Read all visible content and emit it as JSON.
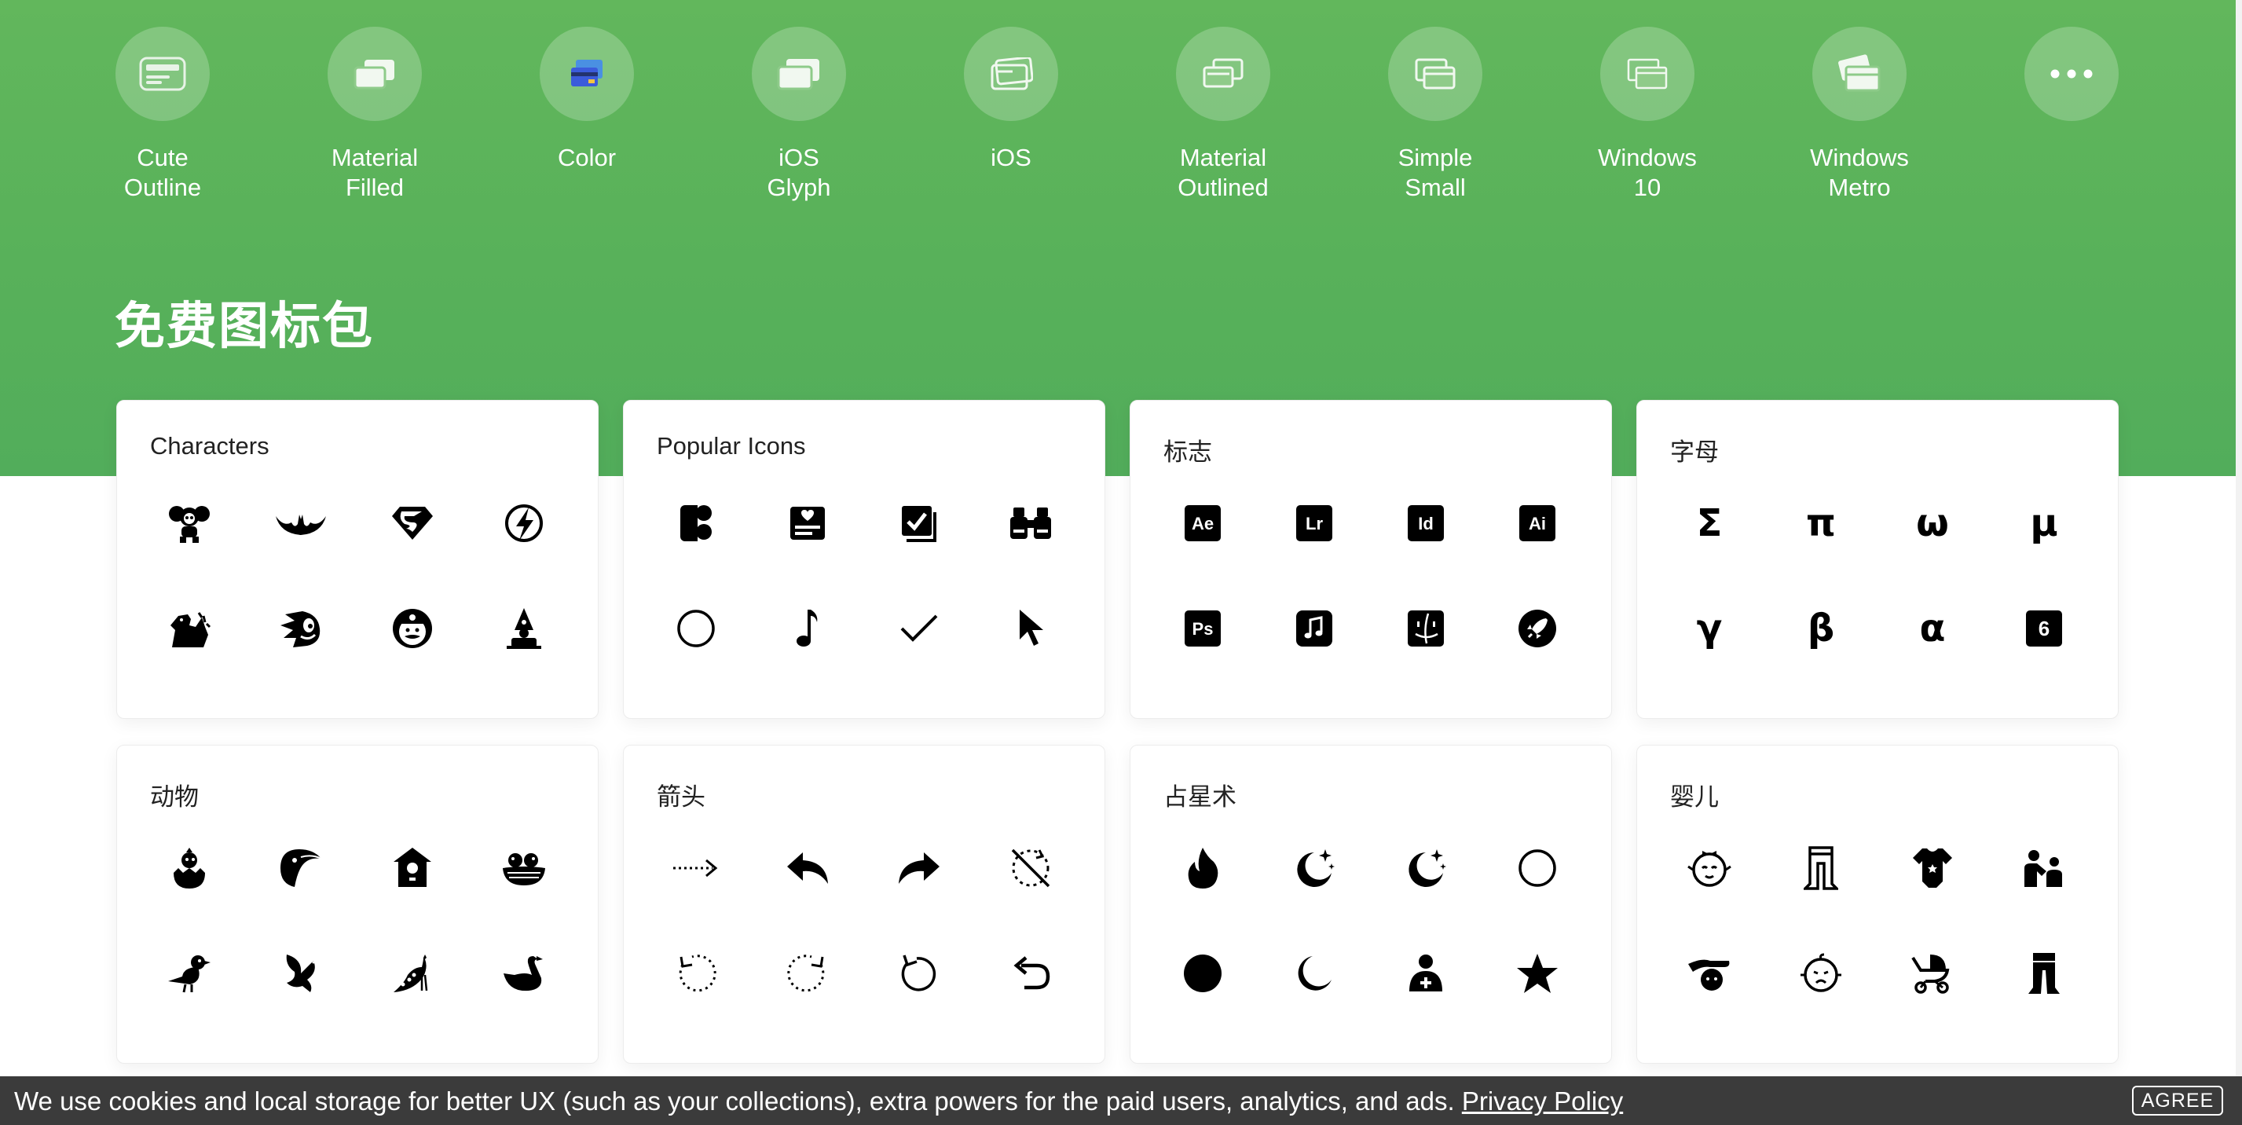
{
  "icon_styles": [
    {
      "label": "Cute\nOutline",
      "icon": "cute-outline-style-icon"
    },
    {
      "label": "Material\nFilled",
      "icon": "material-filled-style-icon"
    },
    {
      "label": "Color",
      "icon": "color-style-icon"
    },
    {
      "label": "iOS\nGlyph",
      "icon": "ios-glyph-style-icon"
    },
    {
      "label": "iOS",
      "icon": "ios-style-icon"
    },
    {
      "label": "Material\nOutlined",
      "icon": "material-outlined-style-icon"
    },
    {
      "label": "Simple\nSmall",
      "icon": "simple-small-style-icon"
    },
    {
      "label": "Windows\n10",
      "icon": "windows-10-style-icon"
    },
    {
      "label": "Windows\nMetro",
      "icon": "windows-metro-style-icon"
    },
    {
      "label": "",
      "icon": "more-icon"
    }
  ],
  "section_title": "免费图标包",
  "packs": [
    {
      "title": "Characters",
      "icons": [
        "cheburashka-icon",
        "batman-icon",
        "superman-icon",
        "flash-icon",
        "godzilla-icon",
        "sonic-icon",
        "mario-icon",
        "gnome-icon"
      ]
    },
    {
      "title": "Popular Icons",
      "icons": [
        "figma-icon",
        "news-card-icon",
        "checklist-icon",
        "binoculars-icon",
        "circle-icon",
        "music-note-icon",
        "checkmark-icon",
        "cursor-icon"
      ]
    },
    {
      "title": "标志",
      "icons": [
        "after-effects-icon",
        "lightroom-icon",
        "indesign-icon",
        "illustrator-icon",
        "photoshop-icon",
        "apple-music-icon",
        "finder-icon",
        "rocket-icon"
      ]
    },
    {
      "title": "字母",
      "icons": [
        "sigma-icon",
        "pi-icon",
        "omega-icon",
        "mu-icon",
        "gamma-icon",
        "beta-icon",
        "alpha-icon",
        "six-icon"
      ]
    },
    {
      "title": "动物",
      "icons": [
        "chick-icon",
        "toucan-icon",
        "birdhouse-icon",
        "bird-nest-icon",
        "sparrow-icon",
        "dove-icon",
        "peacock-icon",
        "swan-icon"
      ]
    },
    {
      "title": "箭头",
      "icons": [
        "dotted-arrow-right-icon",
        "reply-icon",
        "forward-icon",
        "no-sync-icon",
        "rotate-left-dashed-icon",
        "rotate-right-dashed-icon",
        "refresh-icon",
        "undo-icon"
      ]
    },
    {
      "title": "占星术",
      "icons": [
        "fire-icon",
        "moon-stars-icon",
        "moon-stars-icon",
        "circle-icon",
        "filled-circle-icon",
        "crescent-moon-icon",
        "person-plus-icon",
        "star-icon"
      ]
    },
    {
      "title": "婴儿",
      "icons": [
        "baby-girl-icon",
        "tights-icon",
        "baby-bodysuit-icon",
        "parent-child-icon",
        "baby-care-icon",
        "crying-baby-icon",
        "stroller-icon",
        "baby-pants-icon"
      ]
    }
  ],
  "letter_glyphs": {
    "sigma": "Σ",
    "pi": "π",
    "omega": "ω",
    "mu": "μ",
    "gamma": "γ",
    "beta": "β",
    "alpha": "α",
    "six": "6"
  },
  "logo_glyphs": {
    "ae": "Ae",
    "lr": "Lr",
    "id": "Id",
    "ai": "Ai",
    "ps": "Ps"
  },
  "cookie": {
    "text": "We use cookies and local storage for better UX (such as your collections), extra powers for the paid users, analytics, and ads.",
    "link": "Privacy Policy",
    "button": "AGREE"
  },
  "colors": {
    "accent": "#5cb85c",
    "cookie_bg": "#3b3b3b"
  }
}
